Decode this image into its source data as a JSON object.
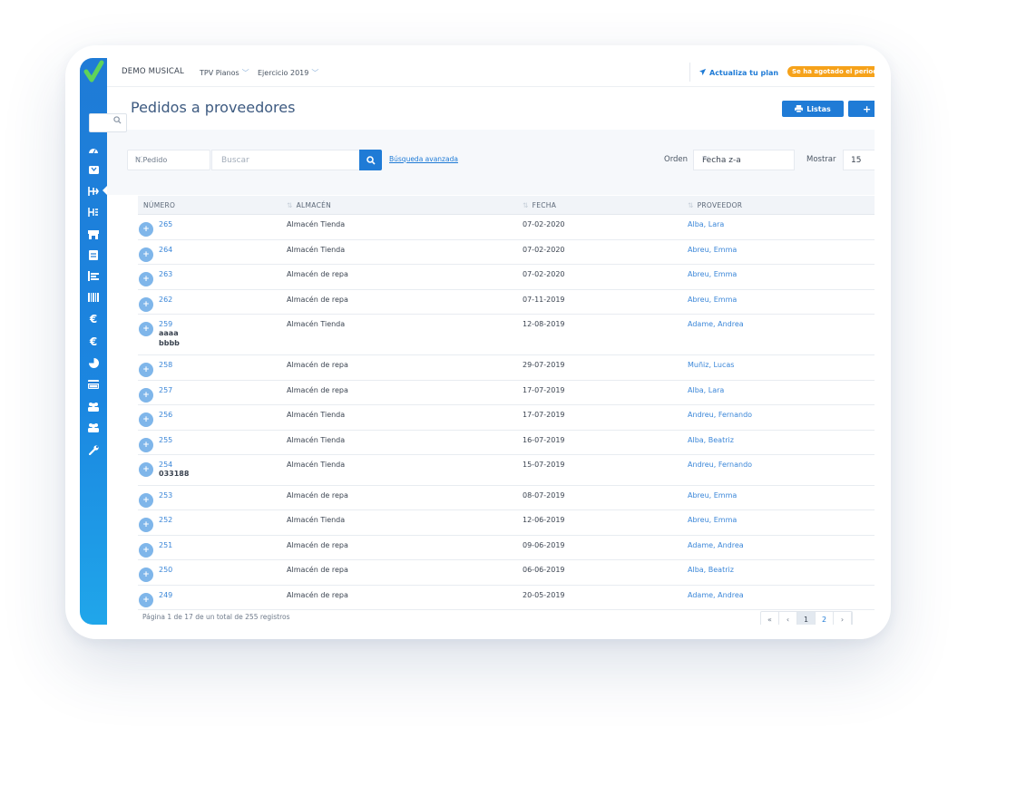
{
  "app": {
    "company": "DEMO MUSICAL",
    "store": "TPV Pianos",
    "exercise": "Ejercicio 2019",
    "upgrade_label": "Actualiza tu plan",
    "expired_badge": "Se ha agotado el periodo"
  },
  "sidebar": {
    "items": [
      {
        "icon": "dashboard-icon"
      },
      {
        "icon": "inbox-icon"
      },
      {
        "icon": "purchase-orders-icon",
        "active": true
      },
      {
        "icon": "delivery-notes-icon"
      },
      {
        "icon": "store-icon"
      },
      {
        "icon": "invoice-icon"
      },
      {
        "icon": "ranking-icon"
      },
      {
        "icon": "barcode-icon"
      },
      {
        "icon": "euro-icon"
      },
      {
        "icon": "euro-icon-2"
      },
      {
        "icon": "pie-chart-icon"
      },
      {
        "icon": "credit-card-icon"
      },
      {
        "icon": "users-icon"
      },
      {
        "icon": "users-icon-2"
      },
      {
        "icon": "wrench-icon"
      }
    ]
  },
  "page": {
    "title": "Pedidos a proveedores",
    "listas_label": "Listas",
    "add_label": "+"
  },
  "filters": {
    "field_select": "N.Pedido",
    "search_placeholder": "Buscar",
    "advanced_label": "Búsqueda avanzada",
    "order_label": "Orden",
    "order_value": "Fecha z-a",
    "show_label": "Mostrar",
    "show_value": "15"
  },
  "table": {
    "columns": [
      "NÚMERO",
      "ALMACÉN",
      "FECHA",
      "PROVEEDOR"
    ],
    "rows": [
      {
        "numero": "265",
        "extra": "",
        "almacen": "Almacén Tienda",
        "fecha": "07-02-2020",
        "proveedor": "Alba, Lara"
      },
      {
        "numero": "264",
        "extra": "",
        "almacen": "Almacén Tienda",
        "fecha": "07-02-2020",
        "proveedor": "Abreu, Emma"
      },
      {
        "numero": "263",
        "extra": "",
        "almacen": "Almacén de repa",
        "fecha": "07-02-2020",
        "proveedor": "Abreu, Emma"
      },
      {
        "numero": "262",
        "extra": "",
        "almacen": "Almacén de repa",
        "fecha": "07-11-2019",
        "proveedor": "Abreu, Emma"
      },
      {
        "numero": "259",
        "extra": "aaaa\nbbbb",
        "almacen": "Almacén Tienda",
        "fecha": "12-08-2019",
        "proveedor": "Adame, Andrea"
      },
      {
        "numero": "258",
        "extra": "",
        "almacen": "Almacén de repa",
        "fecha": "29-07-2019",
        "proveedor": "Muñiz, Lucas"
      },
      {
        "numero": "257",
        "extra": "",
        "almacen": "Almacén de repa",
        "fecha": "17-07-2019",
        "proveedor": "Alba, Lara"
      },
      {
        "numero": "256",
        "extra": "",
        "almacen": "Almacén Tienda",
        "fecha": "17-07-2019",
        "proveedor": "Andreu, Fernando"
      },
      {
        "numero": "255",
        "extra": "",
        "almacen": "Almacén Tienda",
        "fecha": "16-07-2019",
        "proveedor": "Alba, Beatriz"
      },
      {
        "numero": "254",
        "extra": "033188",
        "almacen": "Almacén Tienda",
        "fecha": "15-07-2019",
        "proveedor": "Andreu, Fernando"
      },
      {
        "numero": "253",
        "extra": "",
        "almacen": "Almacén de repa",
        "fecha": "08-07-2019",
        "proveedor": "Abreu, Emma"
      },
      {
        "numero": "252",
        "extra": "",
        "almacen": "Almacén Tienda",
        "fecha": "12-06-2019",
        "proveedor": "Abreu, Emma"
      },
      {
        "numero": "251",
        "extra": "",
        "almacen": "Almacén de repa",
        "fecha": "09-06-2019",
        "proveedor": "Adame, Andrea"
      },
      {
        "numero": "250",
        "extra": "",
        "almacen": "Almacén de repa",
        "fecha": "06-06-2019",
        "proveedor": "Alba, Beatriz"
      },
      {
        "numero": "249",
        "extra": "",
        "almacen": "Almacén de repa",
        "fecha": "20-05-2019",
        "proveedor": "Adame, Andrea"
      }
    ]
  },
  "pagination": {
    "summary": "Página 1 de 17 de un total de 255 registros",
    "first": "«",
    "prev": "‹",
    "pages": [
      "1",
      "2"
    ],
    "current": "1",
    "next": "›"
  },
  "colors": {
    "accent": "#1f7bd6",
    "link": "#3a86d8",
    "warning": "#f6a21a"
  }
}
